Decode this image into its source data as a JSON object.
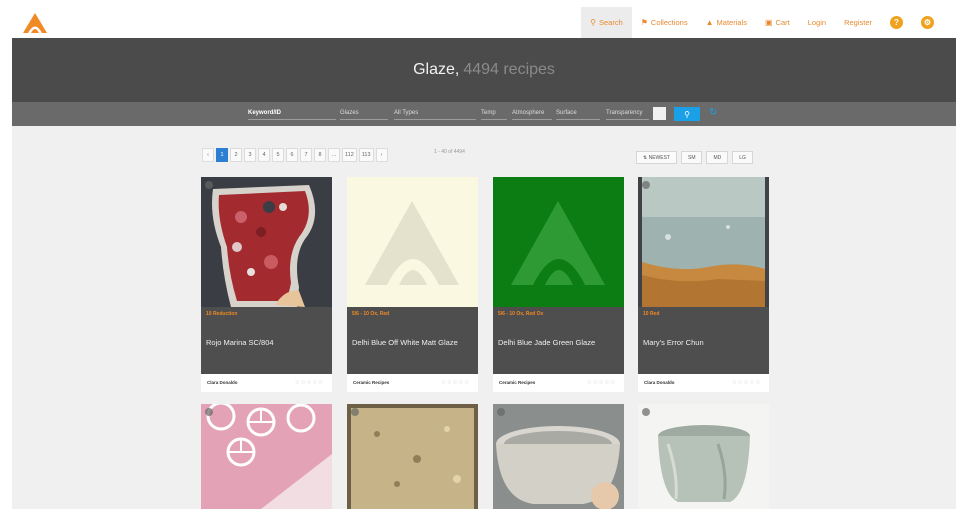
{
  "nav": {
    "search": "Search",
    "collections": "Collections",
    "materials": "Materials",
    "cart": "Cart",
    "login": "Login",
    "register": "Register",
    "help": "?"
  },
  "hero": {
    "title": "Glaze,",
    "count": "4494 recipes"
  },
  "filters": {
    "keyword": "Keyword/ID",
    "type": "Glazes",
    "all_types": "All Types",
    "temp": "Temp",
    "atmosphere": "Atmosphere",
    "surface": "Surface",
    "transparency": "Transparency"
  },
  "pagination": {
    "pages": [
      "‹",
      "1",
      "2",
      "3",
      "4",
      "5",
      "6",
      "7",
      "8",
      "...",
      "112",
      "113",
      "›"
    ],
    "active": "1",
    "results": "1 - 40 of 4494"
  },
  "sort": {
    "newest": "NEWEST",
    "s": "SM",
    "m": "MD",
    "l": "LG"
  },
  "cards": [
    {
      "cone": "10 Reduction",
      "name": "Rojo Marina SC/804",
      "author": "Clara Donaldo",
      "stars": "☆☆☆☆☆",
      "image": "red-tile"
    },
    {
      "cone": "5/6 - 10 Ox, Red",
      "name": "Delhi Blue Off White Matt Glaze",
      "author": "Ceramic Recipes",
      "stars": "☆☆☆☆☆",
      "image": "placeholder-cream"
    },
    {
      "cone": "5/6 - 10 Ox, Red Ox",
      "name": "Delhi Blue Jade Green Glaze",
      "author": "Ceramic Recipes",
      "stars": "☆☆☆☆☆",
      "image": "placeholder-green"
    },
    {
      "cone": "10 Red",
      "name": "Mary's Error Chun",
      "author": "Clara Donaldo",
      "stars": "☆☆☆☆☆",
      "image": "blue-tile"
    }
  ],
  "colors": {
    "accent": "#e8892f",
    "hero_bg": "#4b4b4b",
    "filter_bg": "#6a6a6a",
    "search_blue": "#1aa0e6",
    "pager_active": "#2d7fd3",
    "card_band": "#4e4e4e"
  }
}
